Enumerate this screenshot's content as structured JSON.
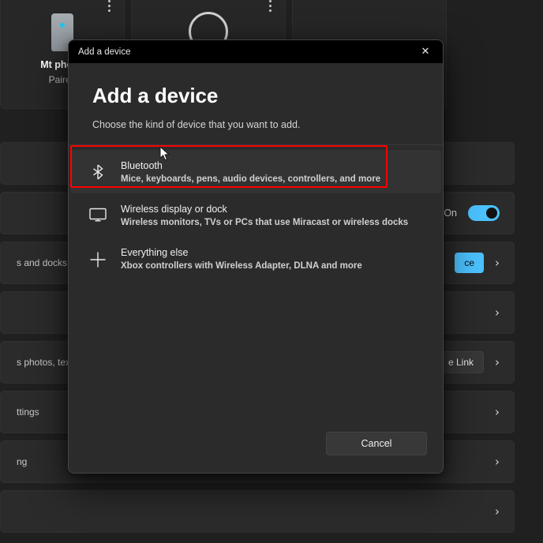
{
  "background": {
    "devices": [
      {
        "name": "Mt phone",
        "status": "Paired",
        "icon": "phone-icon"
      },
      {
        "name": "",
        "status": "",
        "icon": "circle-icon"
      },
      {
        "name": "",
        "status": "",
        "icon": ""
      }
    ],
    "rows": [
      {
        "text": "",
        "state": "",
        "control": "none",
        "chevron": false
      },
      {
        "text": "",
        "state": "On",
        "control": "toggle",
        "chevron": false
      },
      {
        "text": "s and docks, other",
        "state": "",
        "control": "accent",
        "button_label": "ce",
        "chevron": true
      },
      {
        "text": "",
        "state": "",
        "control": "none",
        "chevron": true
      },
      {
        "text": "s photos, texts, and",
        "state": "",
        "control": "ghost",
        "button_label": "e Link",
        "chevron": true
      },
      {
        "text": "ttings",
        "state": "",
        "control": "none",
        "chevron": true
      },
      {
        "text": "ng",
        "state": "",
        "control": "none",
        "chevron": true
      },
      {
        "text": "",
        "state": "",
        "control": "none",
        "chevron": true
      }
    ]
  },
  "dialog": {
    "titlebar": {
      "title": "Add a device",
      "close_label": "✕"
    },
    "heading": "Add a device",
    "subheading": "Choose the kind of device that you want to add.",
    "options": [
      {
        "title": "Bluetooth",
        "description": "Mice, keyboards, pens, audio devices, controllers, and more",
        "icon": "bluetooth-icon",
        "selected": true,
        "highlighted": true
      },
      {
        "title": "Wireless display or dock",
        "description": "Wireless monitors, TVs or PCs that use Miracast or wireless docks",
        "icon": "monitor-icon",
        "selected": false,
        "highlighted": false
      },
      {
        "title": "Everything else",
        "description": "Xbox controllers with Wireless Adapter, DLNA and more",
        "icon": "plus-icon",
        "selected": false,
        "highlighted": false
      }
    ],
    "cancel_label": "Cancel"
  },
  "colors": {
    "accent": "#4cc2ff",
    "highlight": "#ff0000",
    "dialog_bg": "#2b2b2b",
    "titlebar_bg": "#000000",
    "page_bg": "#202020"
  }
}
